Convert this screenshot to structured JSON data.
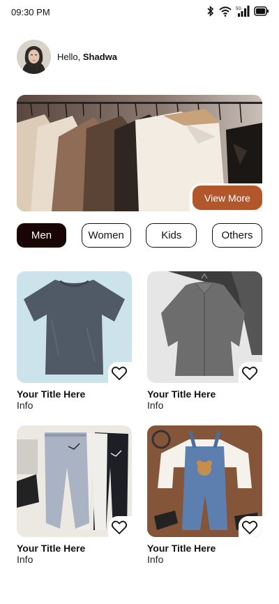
{
  "status": {
    "time": "09:30 PM",
    "network": "5G"
  },
  "user": {
    "greeting": "Hello,",
    "name": "Shadwa"
  },
  "hero": {
    "button_label": "View More"
  },
  "categories": [
    {
      "label": "Men",
      "active": true
    },
    {
      "label": "Women",
      "active": false
    },
    {
      "label": "Kids",
      "active": false
    },
    {
      "label": "Others",
      "active": false
    }
  ],
  "products": [
    {
      "title": "Your Title Here",
      "info": "Info",
      "image": "gray-tshirt"
    },
    {
      "title": "Your Title Here",
      "info": "Info",
      "image": "gray-shirt"
    },
    {
      "title": "Your Title Here",
      "info": "Info",
      "image": "sweatpants"
    },
    {
      "title": "Your Title Here",
      "info": "Info",
      "image": "kids-overalls"
    }
  ],
  "colors": {
    "accent": "#b2572c",
    "active_category": "#1a0505"
  }
}
